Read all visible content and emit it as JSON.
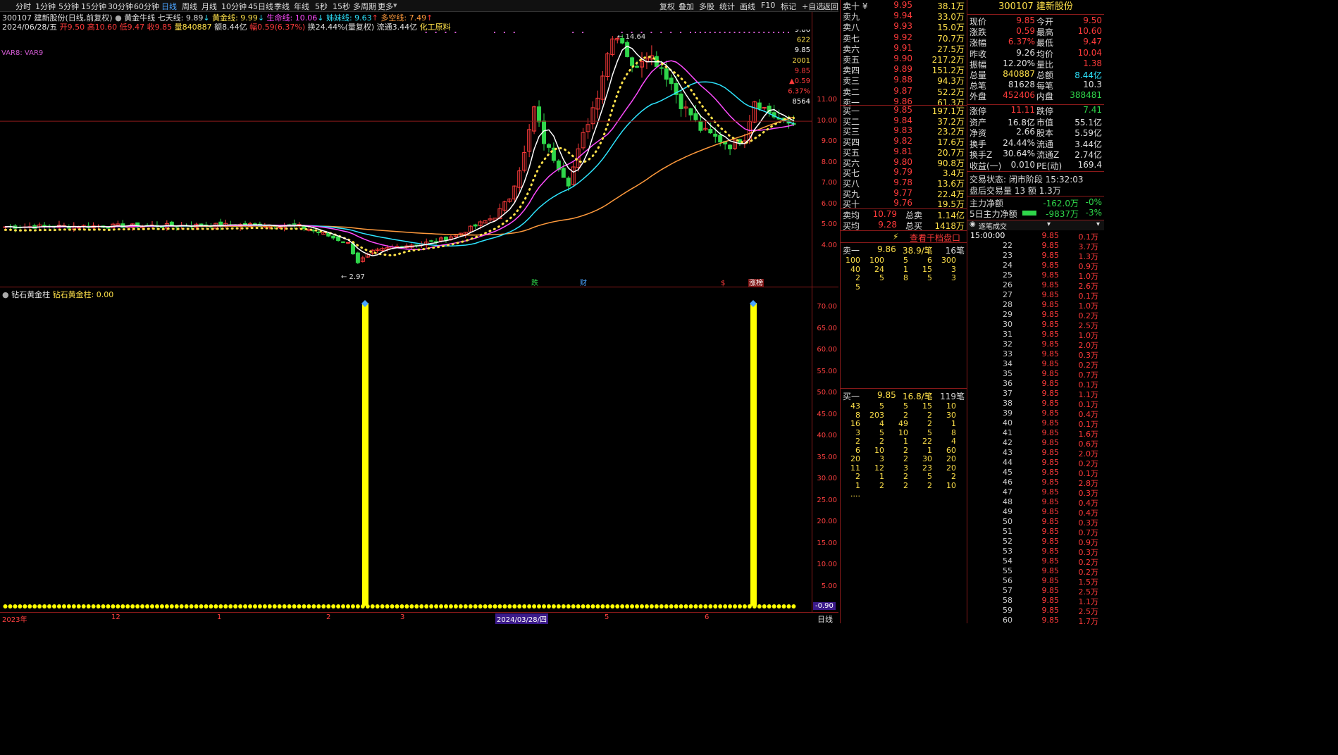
{
  "toolbar": {
    "tabs": [
      "分时",
      "1分钟",
      "5分钟",
      "15分钟",
      "30分钟",
      "60分钟",
      "日线",
      "周线",
      "月线",
      "10分钟",
      "45日线",
      "季线",
      "年线",
      "5秒",
      "15秒",
      "多周期",
      "更多"
    ],
    "active_tab": "日线",
    "right_items": [
      "复权",
      "叠加",
      "多股",
      "统计",
      "画线",
      "F10",
      "标记",
      "+自选",
      "返回"
    ]
  },
  "header": {
    "stock": "300107 建新股份(日线,前复权)",
    "indicator_name": "黄金牛线",
    "ma7_label": "七天线: 9.89",
    "gold_label": "黄金线: 9.99",
    "life_label": "生命线: 10.06",
    "sister_label": "姊妹线: 9.63",
    "longshort_label": "多空线: 7.49",
    "date": "2024/06/28/五",
    "open": "开9.50",
    "high": "高10.60",
    "low": "低9.47",
    "close": "收9.85",
    "volume": "量840887",
    "amount": "额8.44亿",
    "change": "幅0.59(6.37%)",
    "turnover": "换24.44%(量复权)",
    "float": "流通3.44亿",
    "industry": "化工原料",
    "var_label": "VAR8: VAR9"
  },
  "chart_labels": {
    "high_mark": "14.64",
    "low_mark": "2.97",
    "signal_die": "跌",
    "signal_cai": "财",
    "signal_s": "$",
    "signal_zhang": "涨榜",
    "right_tags": [
      "9.86",
      "622",
      "9.85",
      "2001",
      "9.85",
      "▲0.59",
      "6.37%",
      "8564"
    ]
  },
  "sub": {
    "title": "钻石黄金柱",
    "value_label": "钻石黄金柱: 0.00",
    "min_tag": "-0.90"
  },
  "xaxis": {
    "labels": [
      "2023年",
      "12",
      "1",
      "2",
      "3",
      "2024/03/28/四",
      "5",
      "6"
    ],
    "right": "日线"
  },
  "yaxis_main": [
    "11.00",
    "10.00",
    "9.00",
    "8.00",
    "7.00",
    "6.00",
    "5.00",
    "4.00"
  ],
  "yaxis_sub": [
    "70.00",
    "65.00",
    "60.00",
    "55.00",
    "50.00",
    "45.00",
    "40.00",
    "35.00",
    "30.00",
    "25.00",
    "20.00",
    "15.00",
    "10.00",
    "5.00"
  ],
  "orderbook": {
    "sell": [
      {
        "label": "卖十 ¥",
        "price": "9.95",
        "vol": "38.1万"
      },
      {
        "label": "卖九",
        "price": "9.94",
        "vol": "33.0万"
      },
      {
        "label": "卖八",
        "price": "9.93",
        "vol": "15.0万"
      },
      {
        "label": "卖七",
        "price": "9.92",
        "vol": "70.7万"
      },
      {
        "label": "卖六",
        "price": "9.91",
        "vol": "27.5万"
      },
      {
        "label": "卖五",
        "price": "9.90",
        "vol": "217.2万"
      },
      {
        "label": "卖四",
        "price": "9.89",
        "vol": "151.2万"
      },
      {
        "label": "卖三",
        "price": "9.88",
        "vol": "94.3万"
      },
      {
        "label": "卖二",
        "price": "9.87",
        "vol": "52.2万"
      },
      {
        "label": "卖一",
        "price": "9.86",
        "vol": "61.3万"
      }
    ],
    "buy": [
      {
        "label": "买一",
        "price": "9.85",
        "vol": "197.1万"
      },
      {
        "label": "买二",
        "price": "9.84",
        "vol": "37.2万"
      },
      {
        "label": "买三",
        "price": "9.83",
        "vol": "23.2万"
      },
      {
        "label": "买四",
        "price": "9.82",
        "vol": "17.6万"
      },
      {
        "label": "买五",
        "price": "9.81",
        "vol": "20.7万"
      },
      {
        "label": "买六",
        "price": "9.80",
        "vol": "90.8万"
      },
      {
        "label": "买七",
        "price": "9.79",
        "vol": "3.4万"
      },
      {
        "label": "买八",
        "price": "9.78",
        "vol": "13.6万"
      },
      {
        "label": "买九",
        "price": "9.77",
        "vol": "22.4万"
      },
      {
        "label": "买十",
        "price": "9.76",
        "vol": "19.5万"
      }
    ],
    "avg_sell_label": "卖均",
    "avg_sell": "10.79",
    "total_sell_label": "总卖",
    "total_sell": "1.14亿",
    "avg_buy_label": "买均",
    "avg_buy": "9.28",
    "total_buy_label": "总买",
    "total_buy": "1418万",
    "link": "查看千档盘口"
  },
  "queue_sell": {
    "label": "卖一",
    "price": "9.86",
    "per": "38.9/笔",
    "count": "16笔",
    "grid": [
      [
        "100",
        "100",
        "5",
        "6",
        "300"
      ],
      [
        "40",
        "24",
        "1",
        "15",
        "3"
      ],
      [
        "2",
        "5",
        "8",
        "5",
        "3"
      ],
      [
        "5",
        "",
        "",
        "",
        ""
      ]
    ]
  },
  "queue_buy": {
    "label": "买一",
    "price": "9.85",
    "per": "16.8/笔",
    "count": "119笔",
    "grid": [
      [
        "43",
        "5",
        "5",
        "15",
        "10"
      ],
      [
        "8",
        "203",
        "2",
        "2",
        "30"
      ],
      [
        "16",
        "4",
        "49",
        "2",
        "1"
      ],
      [
        "3",
        "5",
        "10",
        "5",
        "8"
      ],
      [
        "2",
        "2",
        "1",
        "22",
        "4"
      ],
      [
        "6",
        "10",
        "2",
        "1",
        "60"
      ],
      [
        "20",
        "3",
        "2",
        "30",
        "20"
      ],
      [
        "11",
        "12",
        "3",
        "23",
        "20"
      ],
      [
        "2",
        "1",
        "2",
        "5",
        "2"
      ],
      [
        "1",
        "2",
        "2",
        "2",
        "10"
      ],
      [
        "....",
        "",
        "",
        "",
        ""
      ]
    ]
  },
  "quote": {
    "title": "300107 建新股份",
    "rows": [
      {
        "k": "现价",
        "v": "9.85",
        "k2": "今开",
        "v2": "9.50",
        "c": "red",
        "c2": "red"
      },
      {
        "k": "涨跌",
        "v": "0.59",
        "k2": "最高",
        "v2": "10.60",
        "c": "red",
        "c2": "red"
      },
      {
        "k": "涨幅",
        "v": "6.37%",
        "k2": "最低",
        "v2": "9.47",
        "c": "red",
        "c2": "red"
      },
      {
        "k": "昨收",
        "v": "9.26",
        "k2": "均价",
        "v2": "10.04",
        "c": "white",
        "c2": "red"
      },
      {
        "k": "振幅",
        "v": "12.20%",
        "k2": "量比",
        "v2": "1.38",
        "c": "white",
        "c2": "red"
      },
      {
        "k": "总量",
        "v": "840887",
        "k2": "总额",
        "v2": "8.44亿",
        "c": "yellow",
        "c2": "cyan"
      },
      {
        "k": "总笔",
        "v": "81628",
        "k2": "每笔",
        "v2": "10.3",
        "c": "white",
        "c2": "white"
      },
      {
        "k": "外盘",
        "v": "452406",
        "k2": "内盘",
        "v2": "388481",
        "c": "red",
        "c2": "green"
      },
      {
        "k": "涨停",
        "v": "11.11",
        "k2": "跌停",
        "v2": "7.41",
        "c": "red",
        "c2": "green"
      },
      {
        "k": "资产",
        "v": "16.8亿",
        "k2": "市值",
        "v2": "55.1亿",
        "c": "white",
        "c2": "white"
      },
      {
        "k": "净资",
        "v": "2.66",
        "k2": "股本",
        "v2": "5.59亿",
        "c": "white",
        "c2": "white"
      },
      {
        "k": "换手",
        "v": "24.44%",
        "k2": "流通",
        "v2": "3.44亿",
        "c": "white",
        "c2": "white"
      },
      {
        "k": "换手Z",
        "v": "30.64%",
        "k2": "流通Z",
        "v2": "2.74亿",
        "c": "white",
        "c2": "white"
      },
      {
        "k": "收益(一)",
        "v": "0.010",
        "k2": "PE(动)",
        "v2": "169.4",
        "c": "white",
        "c2": "white"
      }
    ],
    "trade_status": "交易状态: 闭市阶段 15:32:03",
    "after_hours": "盘后交易量 13 额 1.3万",
    "main_flow_label": "主力净额",
    "main_flow": "-162.0万",
    "main_flow_pct": "-0%",
    "main5_label": "5日主力净额",
    "main5": "-9837万",
    "main5_pct": "-3%",
    "ticks_title": "逐笔成交"
  },
  "ticks": [
    {
      "t": "15:00:00",
      "p": "9.85",
      "v": "0.1万"
    },
    {
      "t": "22",
      "p": "9.85",
      "v": "3.7万"
    },
    {
      "t": "23",
      "p": "9.85",
      "v": "1.3万"
    },
    {
      "t": "24",
      "p": "9.85",
      "v": "0.9万"
    },
    {
      "t": "25",
      "p": "9.85",
      "v": "1.0万"
    },
    {
      "t": "26",
      "p": "9.85",
      "v": "2.6万"
    },
    {
      "t": "27",
      "p": "9.85",
      "v": "0.1万"
    },
    {
      "t": "28",
      "p": "9.85",
      "v": "1.0万"
    },
    {
      "t": "29",
      "p": "9.85",
      "v": "0.2万"
    },
    {
      "t": "30",
      "p": "9.85",
      "v": "2.5万"
    },
    {
      "t": "31",
      "p": "9.85",
      "v": "1.0万"
    },
    {
      "t": "32",
      "p": "9.85",
      "v": "2.0万"
    },
    {
      "t": "33",
      "p": "9.85",
      "v": "0.3万"
    },
    {
      "t": "34",
      "p": "9.85",
      "v": "0.2万"
    },
    {
      "t": "35",
      "p": "9.85",
      "v": "0.7万"
    },
    {
      "t": "36",
      "p": "9.85",
      "v": "0.1万"
    },
    {
      "t": "37",
      "p": "9.85",
      "v": "1.1万"
    },
    {
      "t": "38",
      "p": "9.85",
      "v": "0.1万"
    },
    {
      "t": "39",
      "p": "9.85",
      "v": "0.4万"
    },
    {
      "t": "40",
      "p": "9.85",
      "v": "0.1万"
    },
    {
      "t": "41",
      "p": "9.85",
      "v": "1.6万"
    },
    {
      "t": "42",
      "p": "9.85",
      "v": "0.6万"
    },
    {
      "t": "43",
      "p": "9.85",
      "v": "2.0万"
    },
    {
      "t": "44",
      "p": "9.85",
      "v": "0.2万"
    },
    {
      "t": "45",
      "p": "9.85",
      "v": "0.1万"
    },
    {
      "t": "46",
      "p": "9.85",
      "v": "2.8万"
    },
    {
      "t": "47",
      "p": "9.85",
      "v": "0.3万"
    },
    {
      "t": "48",
      "p": "9.85",
      "v": "0.4万"
    },
    {
      "t": "49",
      "p": "9.85",
      "v": "0.4万"
    },
    {
      "t": "50",
      "p": "9.85",
      "v": "0.3万"
    },
    {
      "t": "51",
      "p": "9.85",
      "v": "0.7万"
    },
    {
      "t": "52",
      "p": "9.85",
      "v": "0.9万"
    },
    {
      "t": "53",
      "p": "9.85",
      "v": "0.3万"
    },
    {
      "t": "54",
      "p": "9.85",
      "v": "0.2万"
    },
    {
      "t": "55",
      "p": "9.85",
      "v": "0.2万"
    },
    {
      "t": "56",
      "p": "9.85",
      "v": "1.5万"
    },
    {
      "t": "57",
      "p": "9.85",
      "v": "2.5万"
    },
    {
      "t": "58",
      "p": "9.85",
      "v": "1.1万"
    },
    {
      "t": "59",
      "p": "9.85",
      "v": "2.5万"
    },
    {
      "t": "60",
      "p": "9.85",
      "v": "1.7万"
    }
  ],
  "colors": {
    "up": "#ff3b3b",
    "down": "#2fd64a",
    "ma7": "#ffffff",
    "gold": "#ffe14a",
    "life": "#ff4cff",
    "sister": "#2ee5ff",
    "longshort": "#ff9a3c",
    "border": "#8a1a1a",
    "column": "#ffff00"
  }
}
